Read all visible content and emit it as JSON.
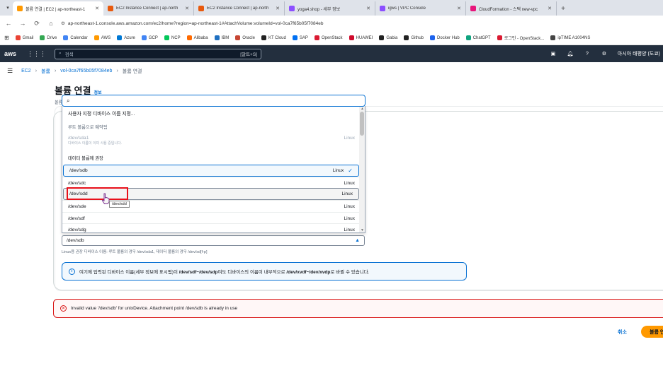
{
  "browser": {
    "tabs": [
      {
        "title": "볼륨 연결 | EC2 | ap-northeast-1",
        "color": "#ff9900",
        "active": true
      },
      {
        "title": "EC2 Instance Connect | ap-north",
        "color": "#e8590c",
        "active": false
      },
      {
        "title": "EC2 Instance Connect | ap-north",
        "color": "#e8590c",
        "active": false
      },
      {
        "title": "yoga4.shop - 세부 정보",
        "color": "#8c4fff",
        "active": false
      },
      {
        "title": "igws | VPC Console",
        "color": "#8c4fff",
        "active": false
      },
      {
        "title": "CloudFormation - 스택 new-vpc",
        "color": "#e7157b",
        "active": false
      }
    ],
    "url": "ap-northeast-1.console.aws.amazon.com/ec2/home?region=ap-northeast-1#AttachVolume:volumeId=vol-0ca7f65b05f7084eb",
    "bookmarks": [
      {
        "label": "Gmail",
        "color": "#ea4335"
      },
      {
        "label": "Drive",
        "color": "#34a853"
      },
      {
        "label": "Calendar",
        "color": "#4285f4"
      },
      {
        "label": "AWS",
        "color": "#ff9900"
      },
      {
        "label": "Azure",
        "color": "#0078d4"
      },
      {
        "label": "GCP",
        "color": "#4285f4"
      },
      {
        "label": "NCP",
        "color": "#03c75a"
      },
      {
        "label": "Alibaba",
        "color": "#ff6a00"
      },
      {
        "label": "IBM",
        "color": "#1f70c1"
      },
      {
        "label": "Oracle",
        "color": "#c74634"
      },
      {
        "label": "KT Cloud",
        "color": "#222222"
      },
      {
        "label": "SAP",
        "color": "#0070f2"
      },
      {
        "label": "OpenStack",
        "color": "#da1a32"
      },
      {
        "label": "HUAWEI",
        "color": "#cf0a2c"
      },
      {
        "label": "Gabia",
        "color": "#222222"
      },
      {
        "label": "Github",
        "color": "#222222"
      },
      {
        "label": "Docker Hub",
        "color": "#1d63ed"
      },
      {
        "label": "ChatGPT",
        "color": "#10a37f"
      },
      {
        "label": "로그인 - OpenStack...",
        "color": "#da1a32"
      },
      {
        "label": "ipTIME A1004NS",
        "color": "#444444"
      }
    ]
  },
  "aws": {
    "logo": "aws",
    "search_placeholder": "검색",
    "search_hint": "[알트+S]",
    "region_user": "아시아 태평양 (도쿄)"
  },
  "breadcrumb": {
    "items": [
      "EC2",
      "볼륨",
      "vol-0ca7f65b05f7084eb"
    ],
    "current": "볼륨 연결"
  },
  "page": {
    "title": "볼륨 연결",
    "info_link": "정보",
    "sub_label": "볼륨"
  },
  "dropdown": {
    "search_icon": "search-icon",
    "custom_option": "사용자 지정 디바이스 이름 지정...",
    "group_root": "루트 볼륨으로 예약됨",
    "root_option": {
      "label": "/dev/sda1",
      "desc": "디바이스 이름이 이미 사용 중입니다.",
      "tag": "Linux"
    },
    "group_data": "데이터 볼륨에 권장",
    "options": [
      {
        "label": "/dev/sdb",
        "tag": "Linux"
      },
      {
        "label": "/dev/sdc",
        "tag": "Linux"
      },
      {
        "label": "/dev/sdd",
        "tag": "Linux"
      },
      {
        "label": "/dev/sde",
        "tag": "Linux"
      },
      {
        "label": "/dev/sdf",
        "tag": "Linux"
      },
      {
        "label": "/dev/sdg",
        "tag": "Linux"
      }
    ],
    "tooltip": "/dev/sdd"
  },
  "device": {
    "selected": "/dev/sdb",
    "help": "Linux용 권장 디바이스 이름: 루트 볼륨의 경우 /dev/sda1, 데이터 볼륨의 경우 /dev/sd[f-p]"
  },
  "info_alert": {
    "pre": "여기에 입력된 디바이스 이름(세부 정보에 표시됨)이 ",
    "bold1": "/dev/sdf~/dev/sdp",
    "mid": "여도 디바이스의 이름이 내부적으로 ",
    "bold2": "/dev/xvdf~/dev/xvdp",
    "post": "로 바뀔 수 있습니다."
  },
  "error_alert": {
    "text": "Invalid value '/dev/sdb' for unixDevice. Attachment point /dev/sdb is already in use"
  },
  "footer": {
    "cancel": "취소",
    "primary": "볼륨 연결"
  }
}
